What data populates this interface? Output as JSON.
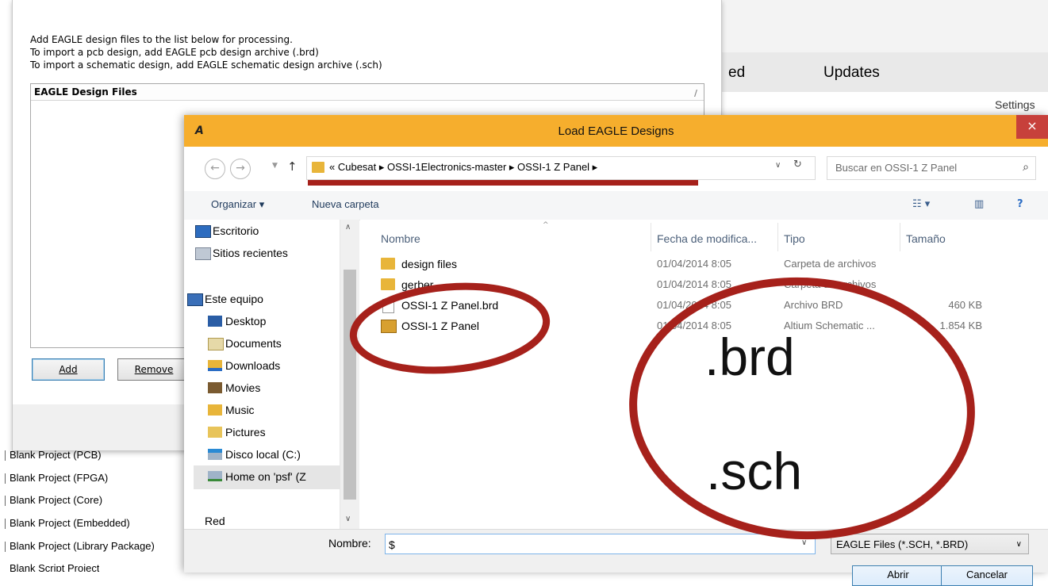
{
  "background": {
    "tabs": {
      "left_partial": "ed",
      "updates": "Updates"
    },
    "settings": "Settings"
  },
  "import_dialog": {
    "instructions": [
      "Add EAGLE design files to the list below for processing.",
      "To import a pcb design, add EAGLE pcb design archive (.brd)",
      "To import a schematic design, add EAGLE schematic design archive (.sch)"
    ],
    "list_header": "EAGLE Design Files",
    "add_label": "Add",
    "remove_label": "Remove"
  },
  "project_list": [
    "Blank Project (PCB)",
    "Blank Project (FPGA)",
    "Blank Project (Core)",
    "Blank Project (Embedded)",
    "Blank Project (Library Package)",
    "Blank Script Project"
  ],
  "load_dialog": {
    "title": "Load EAGLE Designs",
    "app_icon": "A",
    "close": "×",
    "breadcrumb": "«  Cubesat  ▸  OSSI-1Electronics-master  ▸  OSSI-1 Z Panel  ▸",
    "search_placeholder": "Buscar en OSSI-1 Z Panel",
    "toolbar": {
      "organize": "Organizar ▾",
      "new_folder": "Nueva carpeta"
    },
    "nav_items": [
      {
        "label": "Escritorio",
        "icon": "desktop-icon"
      },
      {
        "label": "Sitios recientes",
        "icon": "recent-places-icon"
      },
      {
        "label": "Este equipo",
        "icon": "computer-icon"
      },
      {
        "label": "Desktop",
        "icon": "desktop-folder-icon"
      },
      {
        "label": "Documents",
        "icon": "documents-folder-icon"
      },
      {
        "label": "Downloads",
        "icon": "downloads-folder-icon"
      },
      {
        "label": "Movies",
        "icon": "movies-folder-icon"
      },
      {
        "label": "Music",
        "icon": "music-folder-icon"
      },
      {
        "label": "Pictures",
        "icon": "pictures-folder-icon"
      },
      {
        "label": "Disco local (C:)",
        "icon": "local-disk-icon"
      },
      {
        "label": "Home on 'psf' (Z",
        "icon": "network-drive-icon"
      },
      {
        "label": "Red",
        "icon": "network-icon"
      }
    ],
    "columns": {
      "name": "Nombre",
      "date": "Fecha de modifica...",
      "type": "Tipo",
      "size": "Tamaño"
    },
    "files": [
      {
        "name": "design files",
        "date": "01/04/2014 8:05",
        "type": "Carpeta de archivos",
        "size": "",
        "icon": "folder-icon"
      },
      {
        "name": "gerber",
        "date": "01/04/2014 8:05",
        "type": "Carpeta de archivos",
        "size": "",
        "icon": "folder-icon"
      },
      {
        "name": "OSSI-1 Z Panel.brd",
        "date": "01/04/2014 8:05",
        "type": "Archivo BRD",
        "size": "460 KB",
        "icon": "document-icon"
      },
      {
        "name": "OSSI-1 Z Panel",
        "date": "01/04/2014 8:05",
        "type": "Altium Schematic ...",
        "size": "1.854 KB",
        "icon": "schematic-file-icon"
      }
    ],
    "filename_label": "Nombre:",
    "filename_value": "$",
    "filter": "EAGLE Files (*.SCH, *.BRD)",
    "open_label": "Abrir",
    "cancel_label": "Cancelar"
  },
  "annotations": {
    "brd": ".brd",
    "sch": ".sch"
  },
  "colors": {
    "titlebar": "#f6ae2d",
    "close": "#c7403b",
    "annotation": "#a6211b"
  }
}
